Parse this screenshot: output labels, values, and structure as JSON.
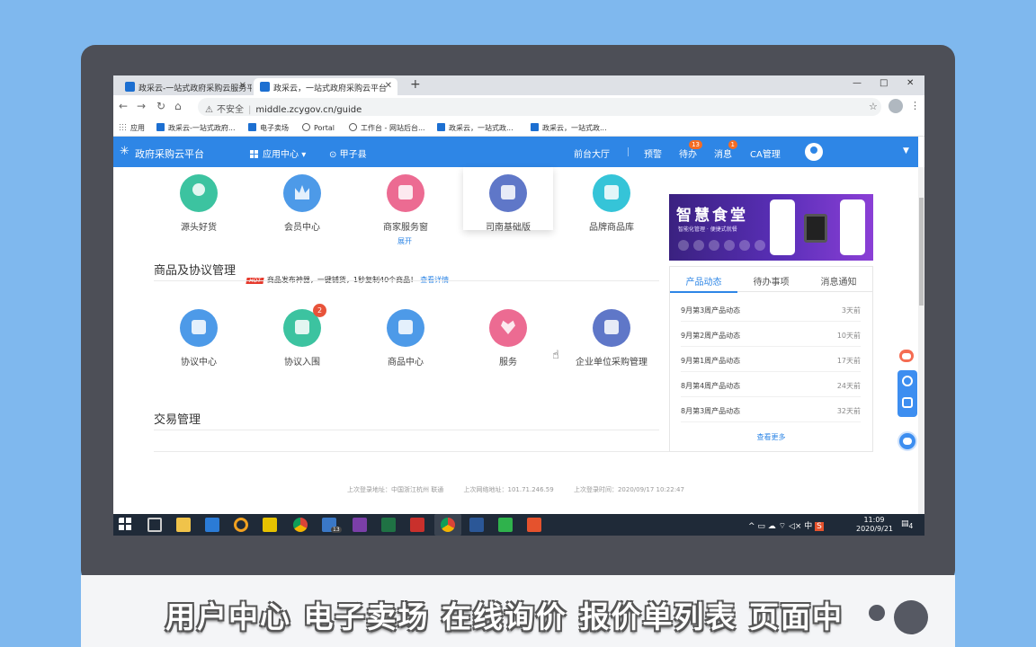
{
  "browser": {
    "tabs": [
      {
        "title": "政采云-一站式政府采购云服务平"
      },
      {
        "title": "政采云，一站式政府采购云平台"
      }
    ],
    "new_tab": "+",
    "window_controls": [
      "—",
      "□",
      "✕"
    ],
    "nav": {
      "back": "←",
      "forward": "→",
      "reload": "↻",
      "home": "⌂"
    },
    "security_text": "不安全",
    "url": "middle.zcygov.cn/guide",
    "bookmarks": [
      {
        "label": "应用",
        "icon": "apps-icon"
      },
      {
        "label": "政采云-一站式政府...",
        "icon": "site-icon"
      },
      {
        "label": "电子卖场",
        "icon": "site-icon"
      },
      {
        "label": "Portal",
        "icon": "globe-icon"
      },
      {
        "label": "工作台 - 网站后台...",
        "icon": "globe-icon"
      },
      {
        "label": "政采云，一站式政...",
        "icon": "site-icon"
      },
      {
        "label": "政采云，一站式政...",
        "icon": "site-icon"
      }
    ]
  },
  "header": {
    "brand": "政府采购云平台",
    "app_center": "应用中心",
    "region": "甲子县",
    "nav": [
      {
        "label": "前台大厅"
      },
      {
        "label": "预警"
      },
      {
        "label": "待办",
        "badge": "13"
      },
      {
        "label": "消息",
        "badge": "1"
      },
      {
        "label": "CA管理"
      }
    ],
    "brand_color": "#2e86e6"
  },
  "top_apps": [
    {
      "label": "源头好货",
      "icon": "people-icon",
      "color": "#3cc3a0"
    },
    {
      "label": "会员中心",
      "icon": "crown-icon",
      "color": "#4d9ae8"
    },
    {
      "label": "商家服务窗",
      "icon": "shop-icon",
      "color": "#ec6b92"
    },
    {
      "label": "司南基础版",
      "icon": "chart-icon",
      "color": "#5f77c8"
    },
    {
      "label": "品牌商品库",
      "icon": "bag-icon",
      "color": "#35c4d8"
    }
  ],
  "expand_label": "展开",
  "section_goods": {
    "title": "商品及协议管理",
    "hot_tag": "HOT",
    "promo": "商品发布神器，一键铺货，1秒复制40个商品！",
    "promo_link": "查看详情",
    "apps": [
      {
        "label": "协议中心",
        "icon": "book-icon",
        "color": "#4d9ae8"
      },
      {
        "label": "协议入围",
        "icon": "download-icon",
        "color": "#3cc3a0",
        "badge": "2"
      },
      {
        "label": "商品中心",
        "icon": "box-icon",
        "color": "#4d9ae8"
      },
      {
        "label": "服务",
        "icon": "heart-icon",
        "color": "#ec6b92"
      },
      {
        "label": "企业单位采购管理",
        "icon": "cart-icon",
        "color": "#5f77c8"
      }
    ]
  },
  "section_trade": {
    "title": "交易管理"
  },
  "banner": {
    "title": "智慧食堂",
    "subtitle": "智能化管理 · 便捷式就餐"
  },
  "panel": {
    "tabs": [
      "产品动态",
      "待办事项",
      "消息通知"
    ],
    "active_tab": 0,
    "items": [
      {
        "title": "9月第3周产品动态",
        "time": "3天前"
      },
      {
        "title": "9月第2周产品动态",
        "time": "10天前"
      },
      {
        "title": "9月第1周产品动态",
        "time": "17天前"
      },
      {
        "title": "8月第4周产品动态",
        "time": "24天前"
      },
      {
        "title": "8月第3周产品动态",
        "time": "32天前"
      }
    ],
    "more": "查看更多"
  },
  "footer": {
    "last_login_location": "上次登录地址：中国浙江杭州 联通",
    "last_ip": "上次网络地址：101.71.246.59",
    "last_login_time": "上次登录时间：2020/09/17 10:22:47"
  },
  "taskbar": {
    "time": "11:09",
    "date": "2020/9/21",
    "ime": "中",
    "notification_count": "4",
    "edge_badge": "13"
  },
  "subtitle": "用户中心 电子卖场 在线询价 报价单列表 页面中"
}
